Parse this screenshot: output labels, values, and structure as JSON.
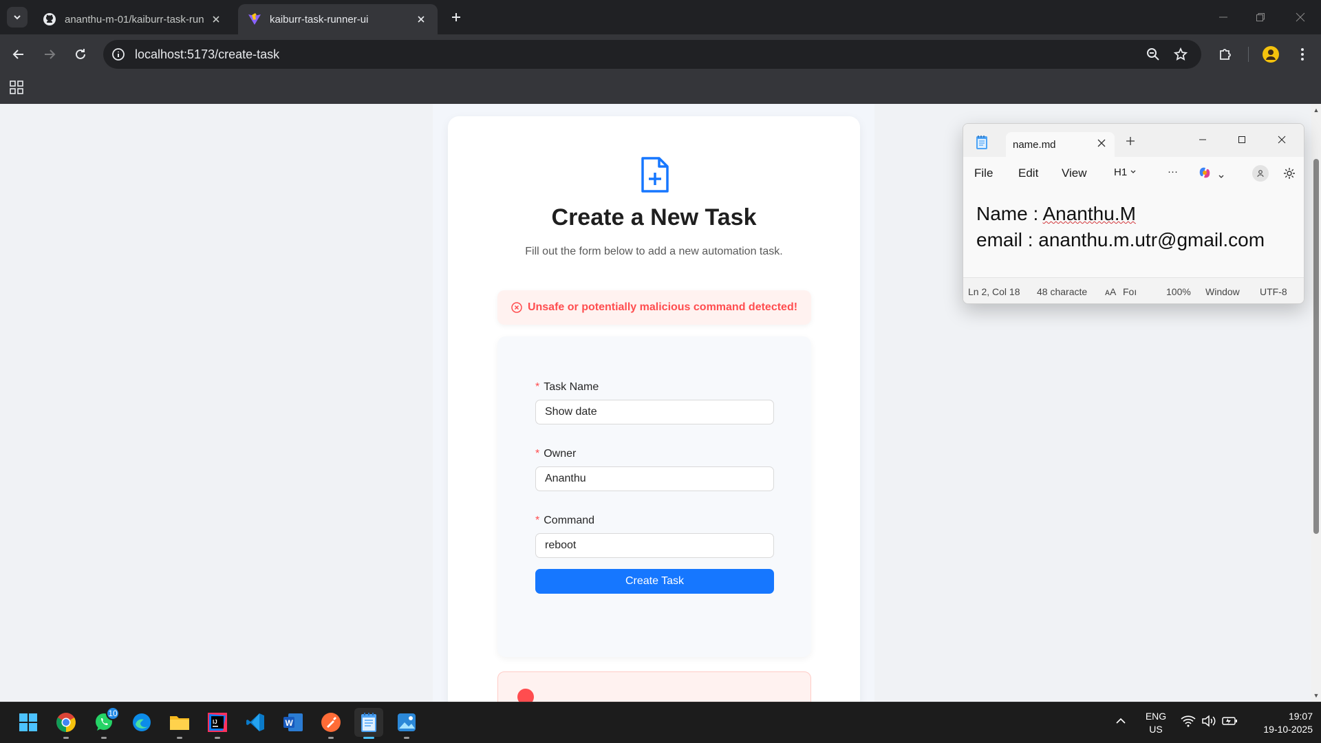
{
  "browser": {
    "tabs": [
      {
        "title": "ananthu-m-01/kaiburr-task-runner-ui",
        "icon": "github-icon",
        "active": false
      },
      {
        "title": "kaiburr-task-runner-ui",
        "icon": "vite-icon",
        "active": true
      }
    ],
    "url": "localhost:5173/create-task"
  },
  "page": {
    "title": "Create a New Task",
    "subtitle": "Fill out the form below to add a new automation task.",
    "error_message": "Unsafe or potentially malicious command detected!",
    "form": {
      "task_name": {
        "label": "Task Name",
        "value": "Show date"
      },
      "owner": {
        "label": "Owner",
        "value": "Ananthu"
      },
      "command": {
        "label": "Command",
        "value": "reboot"
      },
      "submit_label": "Create Task"
    }
  },
  "notepad": {
    "tab_name": "name.md",
    "menu": {
      "file": "File",
      "edit": "Edit",
      "view": "View",
      "heading": "H1",
      "more": "···"
    },
    "content": {
      "line1_prefix": "Name : ",
      "line1_name": "Ananthu.M",
      "line2": "email : ananthu.m.utr@gmail.com"
    },
    "status": {
      "position": "Ln 2, Col 18",
      "chars": "48 characte",
      "font": "Foı",
      "zoom": "100%",
      "line_ending": "Window",
      "encoding": "UTF-8"
    }
  },
  "taskbar": {
    "whatsapp_badge": "10",
    "lang_line1": "ENG",
    "lang_line2": "US",
    "time": "19:07",
    "date": "19-10-2025"
  },
  "colors": {
    "primary": "#1677ff",
    "error": "#ff4d4f",
    "error_bg": "#fff2f0",
    "browser_dark": "#202124"
  }
}
